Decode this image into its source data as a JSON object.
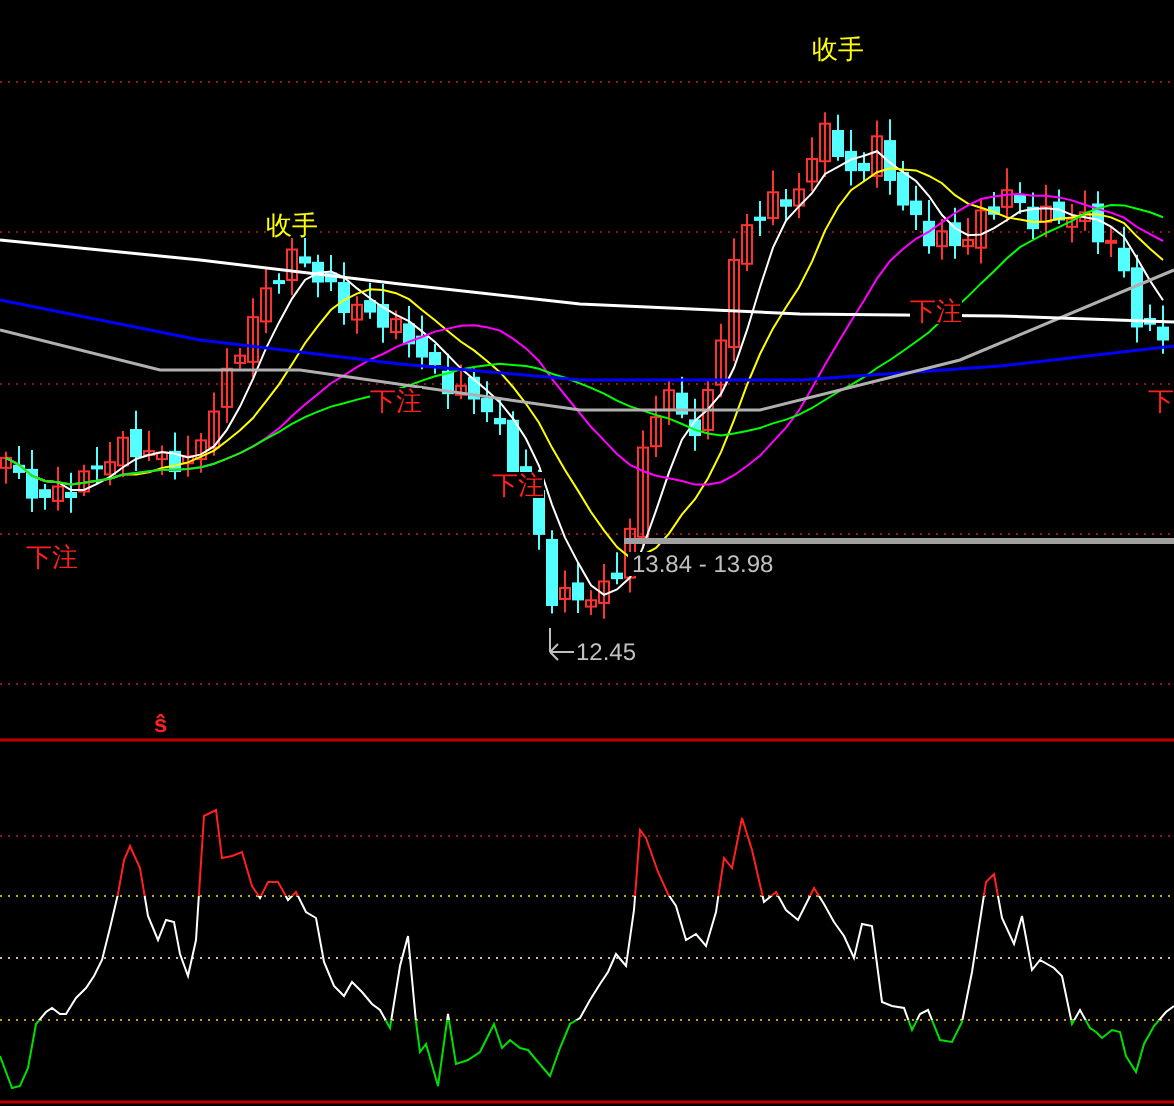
{
  "price_panel": {
    "markers": [
      {
        "text": "收手",
        "kind": "sell"
      },
      {
        "text": "收手",
        "kind": "sell"
      },
      {
        "text": "下注",
        "kind": "buy"
      },
      {
        "text": "下注",
        "kind": "buy"
      },
      {
        "text": "下注",
        "kind": "buy"
      },
      {
        "text": "下注",
        "kind": "buy"
      },
      {
        "text": "下",
        "kind": "buy"
      }
    ],
    "range_label": "13.84 - 13.98",
    "low_label": "12.45"
  },
  "indicator_panel": {
    "mark": "ŝ"
  }
}
